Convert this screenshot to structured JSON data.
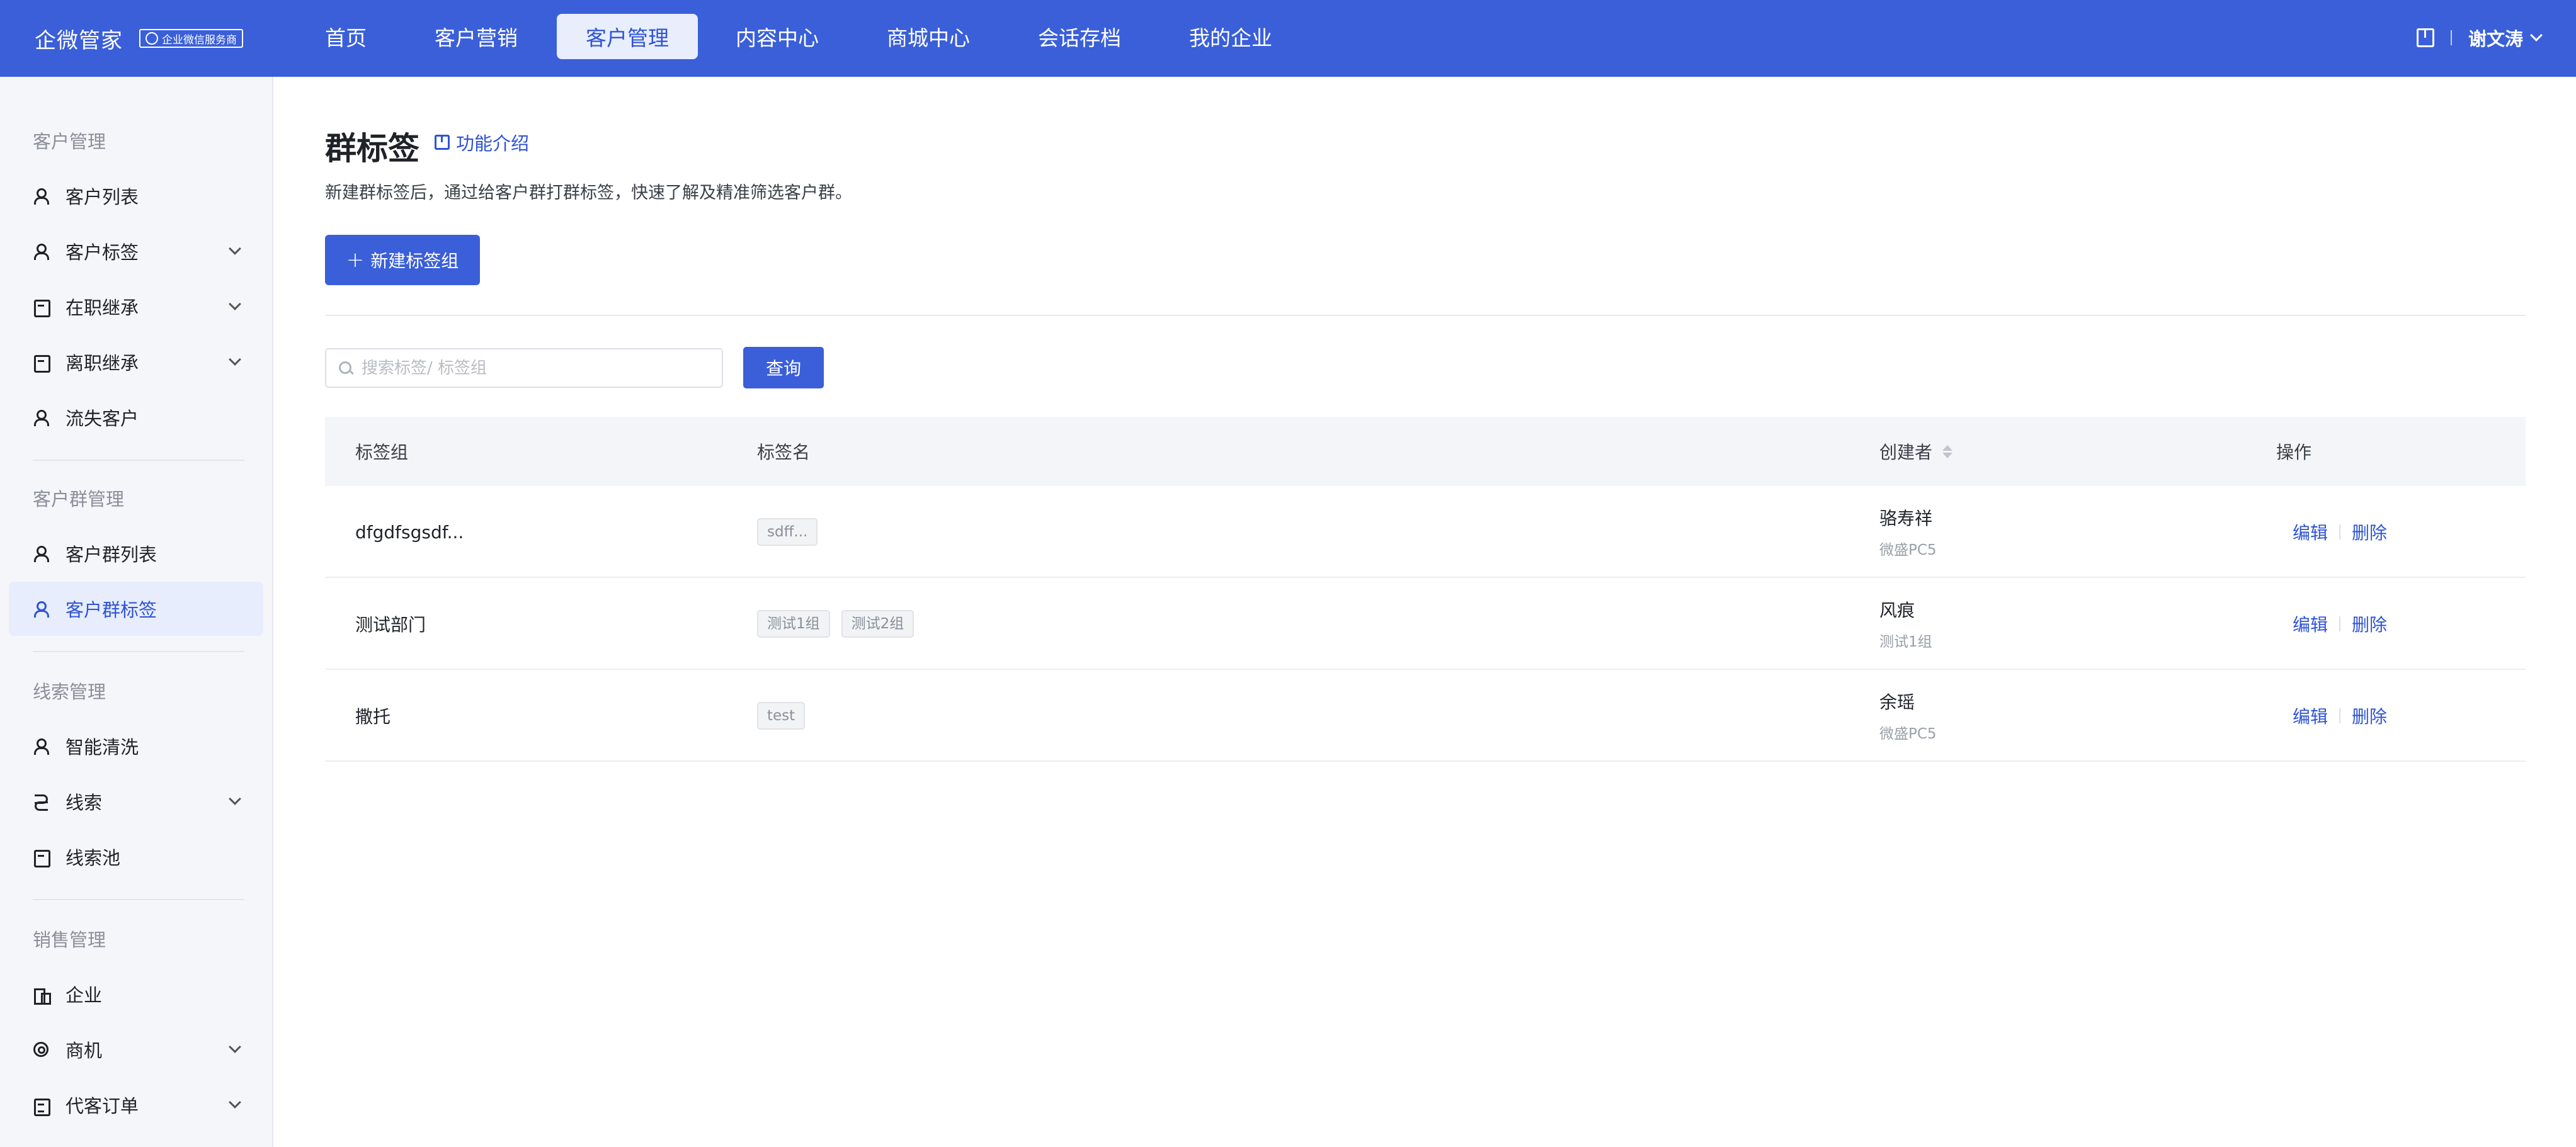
{
  "topbar": {
    "brand": "企微管家",
    "badge": "企业微信服务商",
    "nav": [
      "首页",
      "客户营销",
      "客户管理",
      "内容中心",
      "商城中心",
      "会话存档",
      "我的企业"
    ],
    "active_nav": "客户管理",
    "user": "谢文涛"
  },
  "sidebar": {
    "sections": [
      {
        "title": "客户管理",
        "items": [
          {
            "label": "客户列表",
            "icon": "user-icon",
            "expandable": false
          },
          {
            "label": "客户标签",
            "icon": "tag-user-icon",
            "expandable": true
          },
          {
            "label": "在职继承",
            "icon": "transfer-icon",
            "expandable": true
          },
          {
            "label": "离职继承",
            "icon": "exit-icon",
            "expandable": true
          },
          {
            "label": "流失客户",
            "icon": "lost-user-icon",
            "expandable": false
          }
        ]
      },
      {
        "title": "客户群管理",
        "items": [
          {
            "label": "客户群列表",
            "icon": "group-icon",
            "expandable": false
          },
          {
            "label": "客户群标签",
            "icon": "group-tag-icon",
            "expandable": false,
            "active": true
          }
        ]
      },
      {
        "title": "线索管理",
        "items": [
          {
            "label": "智能清洗",
            "icon": "clean-icon",
            "expandable": false
          },
          {
            "label": "线索",
            "icon": "lead-icon",
            "expandable": true
          },
          {
            "label": "线索池",
            "icon": "pool-icon",
            "expandable": false
          }
        ]
      },
      {
        "title": "销售管理",
        "items": [
          {
            "label": "企业",
            "icon": "building-icon",
            "expandable": false
          },
          {
            "label": "商机",
            "icon": "target-icon",
            "expandable": true
          },
          {
            "label": "代客订单",
            "icon": "order-icon",
            "expandable": true
          }
        ]
      }
    ]
  },
  "main": {
    "title": "群标签",
    "intro_link": "功能介绍",
    "description": "新建群标签后，通过给客户群打群标签，快速了解及精准筛选客户群。",
    "new_button": "新建标签组",
    "search_placeholder": "搜索标签/ 标签组",
    "query_button": "查询",
    "table": {
      "headers": {
        "group": "标签组",
        "tags": "标签名",
        "creator": "创建者",
        "ops": "操作"
      },
      "rows": [
        {
          "group": "dfgdfsgsdf...",
          "tags": [
            "sdff..."
          ],
          "creator": "骆寿祥",
          "creator_sub": "微盛PC5",
          "edit": "编辑",
          "delete": "删除"
        },
        {
          "group": "测试部门",
          "tags": [
            "测试1组",
            "测试2组"
          ],
          "creator": "风痕",
          "creator_sub": "测试1组",
          "edit": "编辑",
          "delete": "删除"
        },
        {
          "group": "撒托",
          "tags": [
            "test"
          ],
          "creator": "余瑶",
          "creator_sub": "微盛PC5",
          "edit": "编辑",
          "delete": "删除"
        }
      ]
    }
  },
  "colors": {
    "primary": "#3a5fd9",
    "active_bg": "#e7edfc",
    "link": "#2f54d4"
  }
}
